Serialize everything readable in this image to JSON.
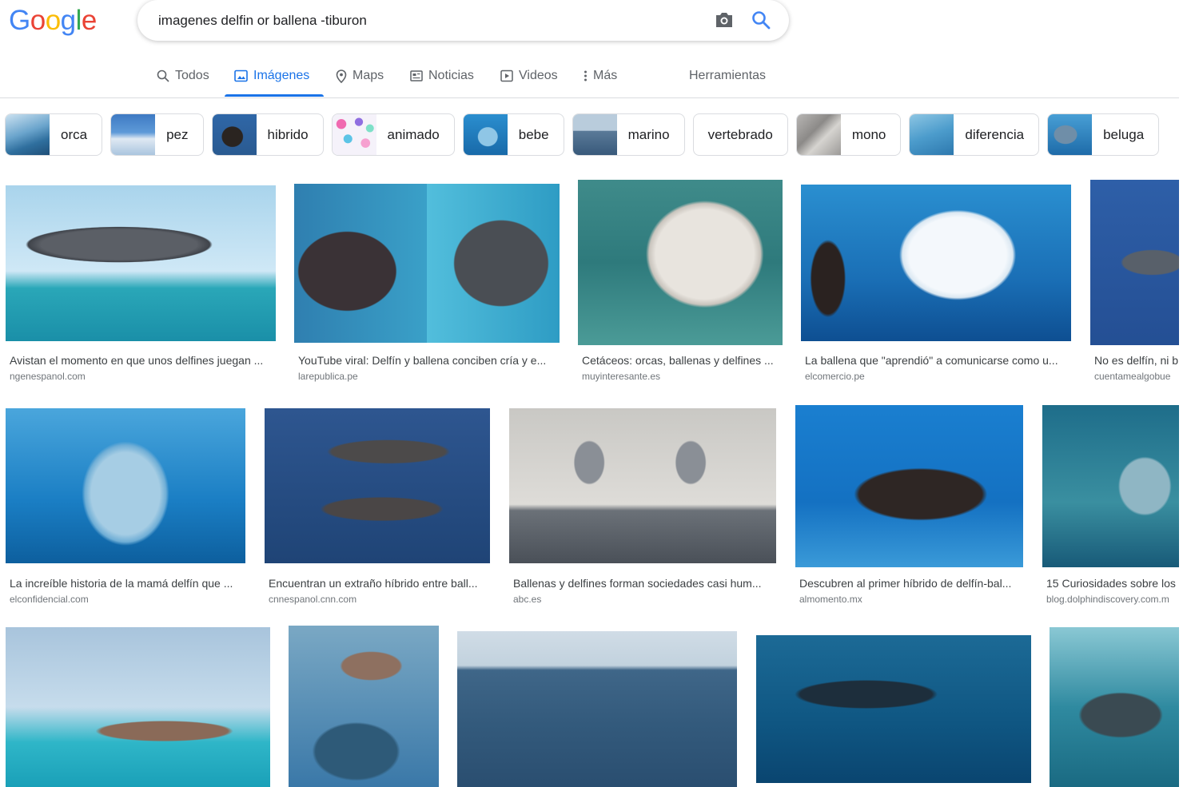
{
  "logo": [
    "G",
    "o",
    "o",
    "g",
    "l",
    "e"
  ],
  "logo_colors": [
    "#4285F4",
    "#EA4335",
    "#FBBC05",
    "#4285F4",
    "#34A853",
    "#EA4335"
  ],
  "search": {
    "query": "imagenes delfin or ballena -tiburon"
  },
  "tabs": [
    {
      "label": "Todos",
      "icon": "search-icon"
    },
    {
      "label": "Imágenes",
      "icon": "image-icon",
      "active": true
    },
    {
      "label": "Maps",
      "icon": "map-pin-icon"
    },
    {
      "label": "Noticias",
      "icon": "news-icon"
    },
    {
      "label": "Videos",
      "icon": "video-icon"
    },
    {
      "label": "Más",
      "icon": "more-vert-icon"
    },
    {
      "label": "Herramientas"
    }
  ],
  "chips": [
    {
      "label": "orca"
    },
    {
      "label": "pez"
    },
    {
      "label": "hibrido"
    },
    {
      "label": "animado"
    },
    {
      "label": "bebe"
    },
    {
      "label": "marino"
    },
    {
      "label": "vertebrado"
    },
    {
      "label": "mono"
    },
    {
      "label": "diferencia"
    },
    {
      "label": "beluga"
    }
  ],
  "results": [
    {
      "title": "Avistan el momento en que unos delfines juegan ...",
      "source": "ngenespanol.com"
    },
    {
      "title": "YouTube viral: Delfín y ballena conciben cría y e...",
      "source": "larepublica.pe"
    },
    {
      "title": "Cetáceos: orcas, ballenas y delfines ...",
      "source": "muyinteresante.es"
    },
    {
      "title": "La ballena que \"aprendió\" a comunicarse como u...",
      "source": "elcomercio.pe"
    },
    {
      "title": "No es delfín, ni b",
      "source": "cuentamealgobue"
    },
    {
      "title": "La increíble historia de la mamá delfín que ...",
      "source": "elconfidencial.com"
    },
    {
      "title": "Encuentran un extraño híbrido entre ball...",
      "source": "cnnespanol.cnn.com"
    },
    {
      "title": "Ballenas y delfines forman sociedades casi hum...",
      "source": "abc.es"
    },
    {
      "title": "Descubren al primer híbrido de delfín-bal...",
      "source": "almomento.mx"
    },
    {
      "title": "15 Curiosidades sobre los",
      "source": "blog.dolphindiscovery.com.m"
    },
    {
      "title": "",
      "source": ""
    },
    {
      "title": "",
      "source": ""
    },
    {
      "title": "",
      "source": ""
    },
    {
      "title": "",
      "source": ""
    },
    {
      "title": "",
      "source": ""
    }
  ]
}
